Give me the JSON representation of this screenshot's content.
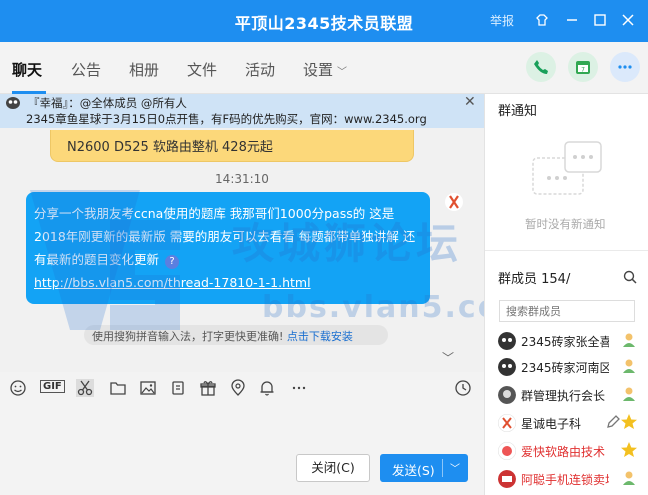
{
  "titlebar": {
    "title": "平顶山2345技术员联盟",
    "report": "举报"
  },
  "tabs": [
    {
      "label": "聊天"
    },
    {
      "label": "公告"
    },
    {
      "label": "相册"
    },
    {
      "label": "文件"
    },
    {
      "label": "活动"
    },
    {
      "label": "设置"
    }
  ],
  "notice": {
    "line1": "『幸福』：@全体成员 @所有人",
    "line2": "2345章鱼星球于3月15日0点开售，有F码的优先购买，官网：www.2345.org",
    "close": "✕"
  },
  "messages": {
    "prev": "N2600 D525 软路由整机 428元起",
    "time": "14:31:10",
    "body": "分享一个我朋友考ccna使用的题库 我那哥们1000分pass的 这是2018年刚更新的最新版 需要的朋友可以去看看 每题都带单独讲解 还有最新的题目变化更新",
    "link": "http://bbs.vlan5.com/thread-17810-1-1.html"
  },
  "ime_tip": {
    "text": "使用搜狗拼音输入法，打字更快更准确!",
    "link": "点击下载安装"
  },
  "watermark": {
    "cn": "攻城狮论坛",
    "url": "bbs.vlan5.com"
  },
  "buttons": {
    "close": "关闭(C)",
    "send": "发送(S)"
  },
  "side": {
    "notice_title": "群通知",
    "notice_empty": "暂时没有新通知",
    "members_title": "群成员 154/",
    "search_placeholder": "搜索群成员",
    "members": [
      {
        "name": "2345砖家张全喜",
        "color": "#222",
        "badge": "person"
      },
      {
        "name": "2345砖家河南区",
        "color": "#222",
        "badge": "person"
      },
      {
        "name": "群管理执行会长",
        "color": "#222",
        "badge": "person"
      },
      {
        "name": "星诚电子科",
        "color": "#222",
        "badge": "star"
      },
      {
        "name": "爱快软路由技术",
        "color": "#e03030",
        "badge": "star"
      },
      {
        "name": "阿聪手机连锁卖场",
        "color": "#e03030",
        "badge": "person"
      }
    ]
  },
  "colors": {
    "accent": "#1e8ef0",
    "bubble": "#13a3f5",
    "notice_bg": "#cfe3f6",
    "highlight": "#e03030"
  }
}
